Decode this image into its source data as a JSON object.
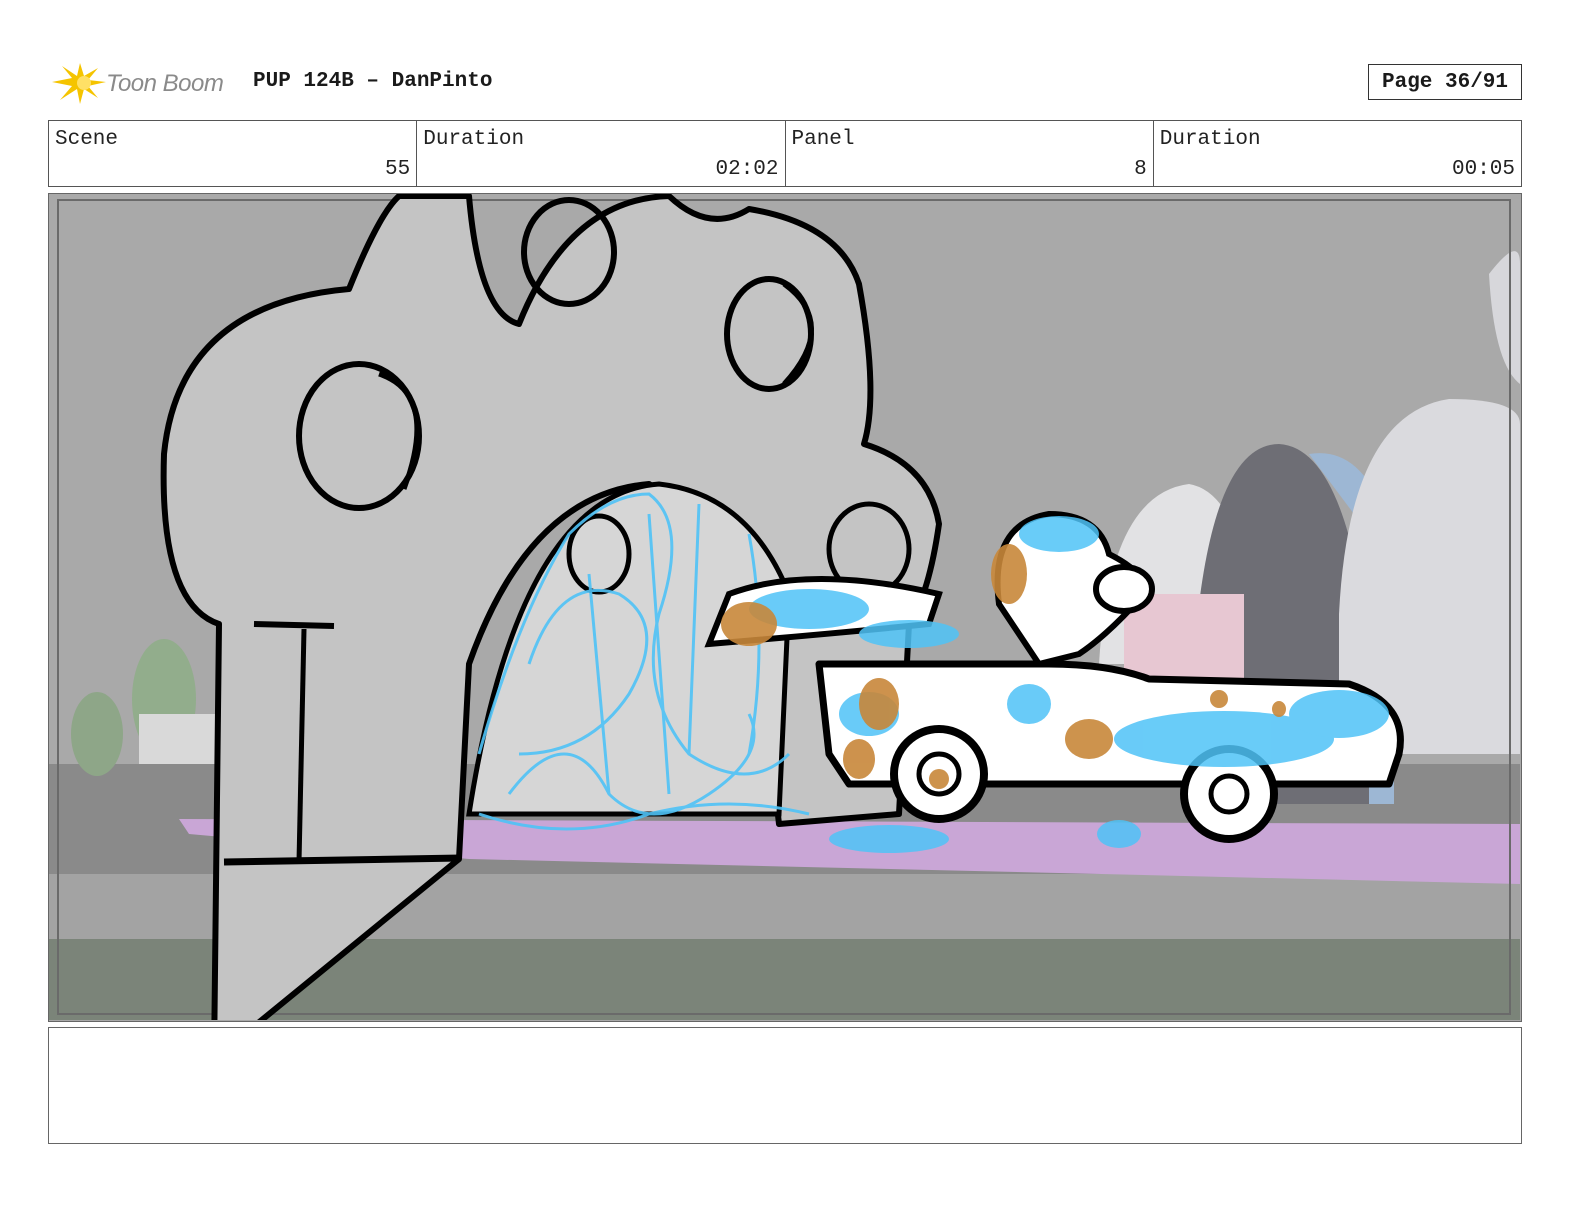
{
  "header": {
    "logo_text": "Toon Boom",
    "title": "PUP 124B – DanPinto",
    "page_label": "Page 36/91"
  },
  "info": {
    "scene_label": "Scene",
    "scene_value": "55",
    "scene_duration_label": "Duration",
    "scene_duration_value": "02:02",
    "panel_label": "Panel",
    "panel_value": "8",
    "panel_duration_label": "Duration",
    "panel_duration_value": "00:05"
  },
  "caption": {
    "text": ""
  },
  "colors": {
    "sketch_blue": "#4fc3f7",
    "sketch_orange": "#c8873a",
    "road_pink": "#c9a6d6",
    "logo_yellow": "#f5c400"
  }
}
